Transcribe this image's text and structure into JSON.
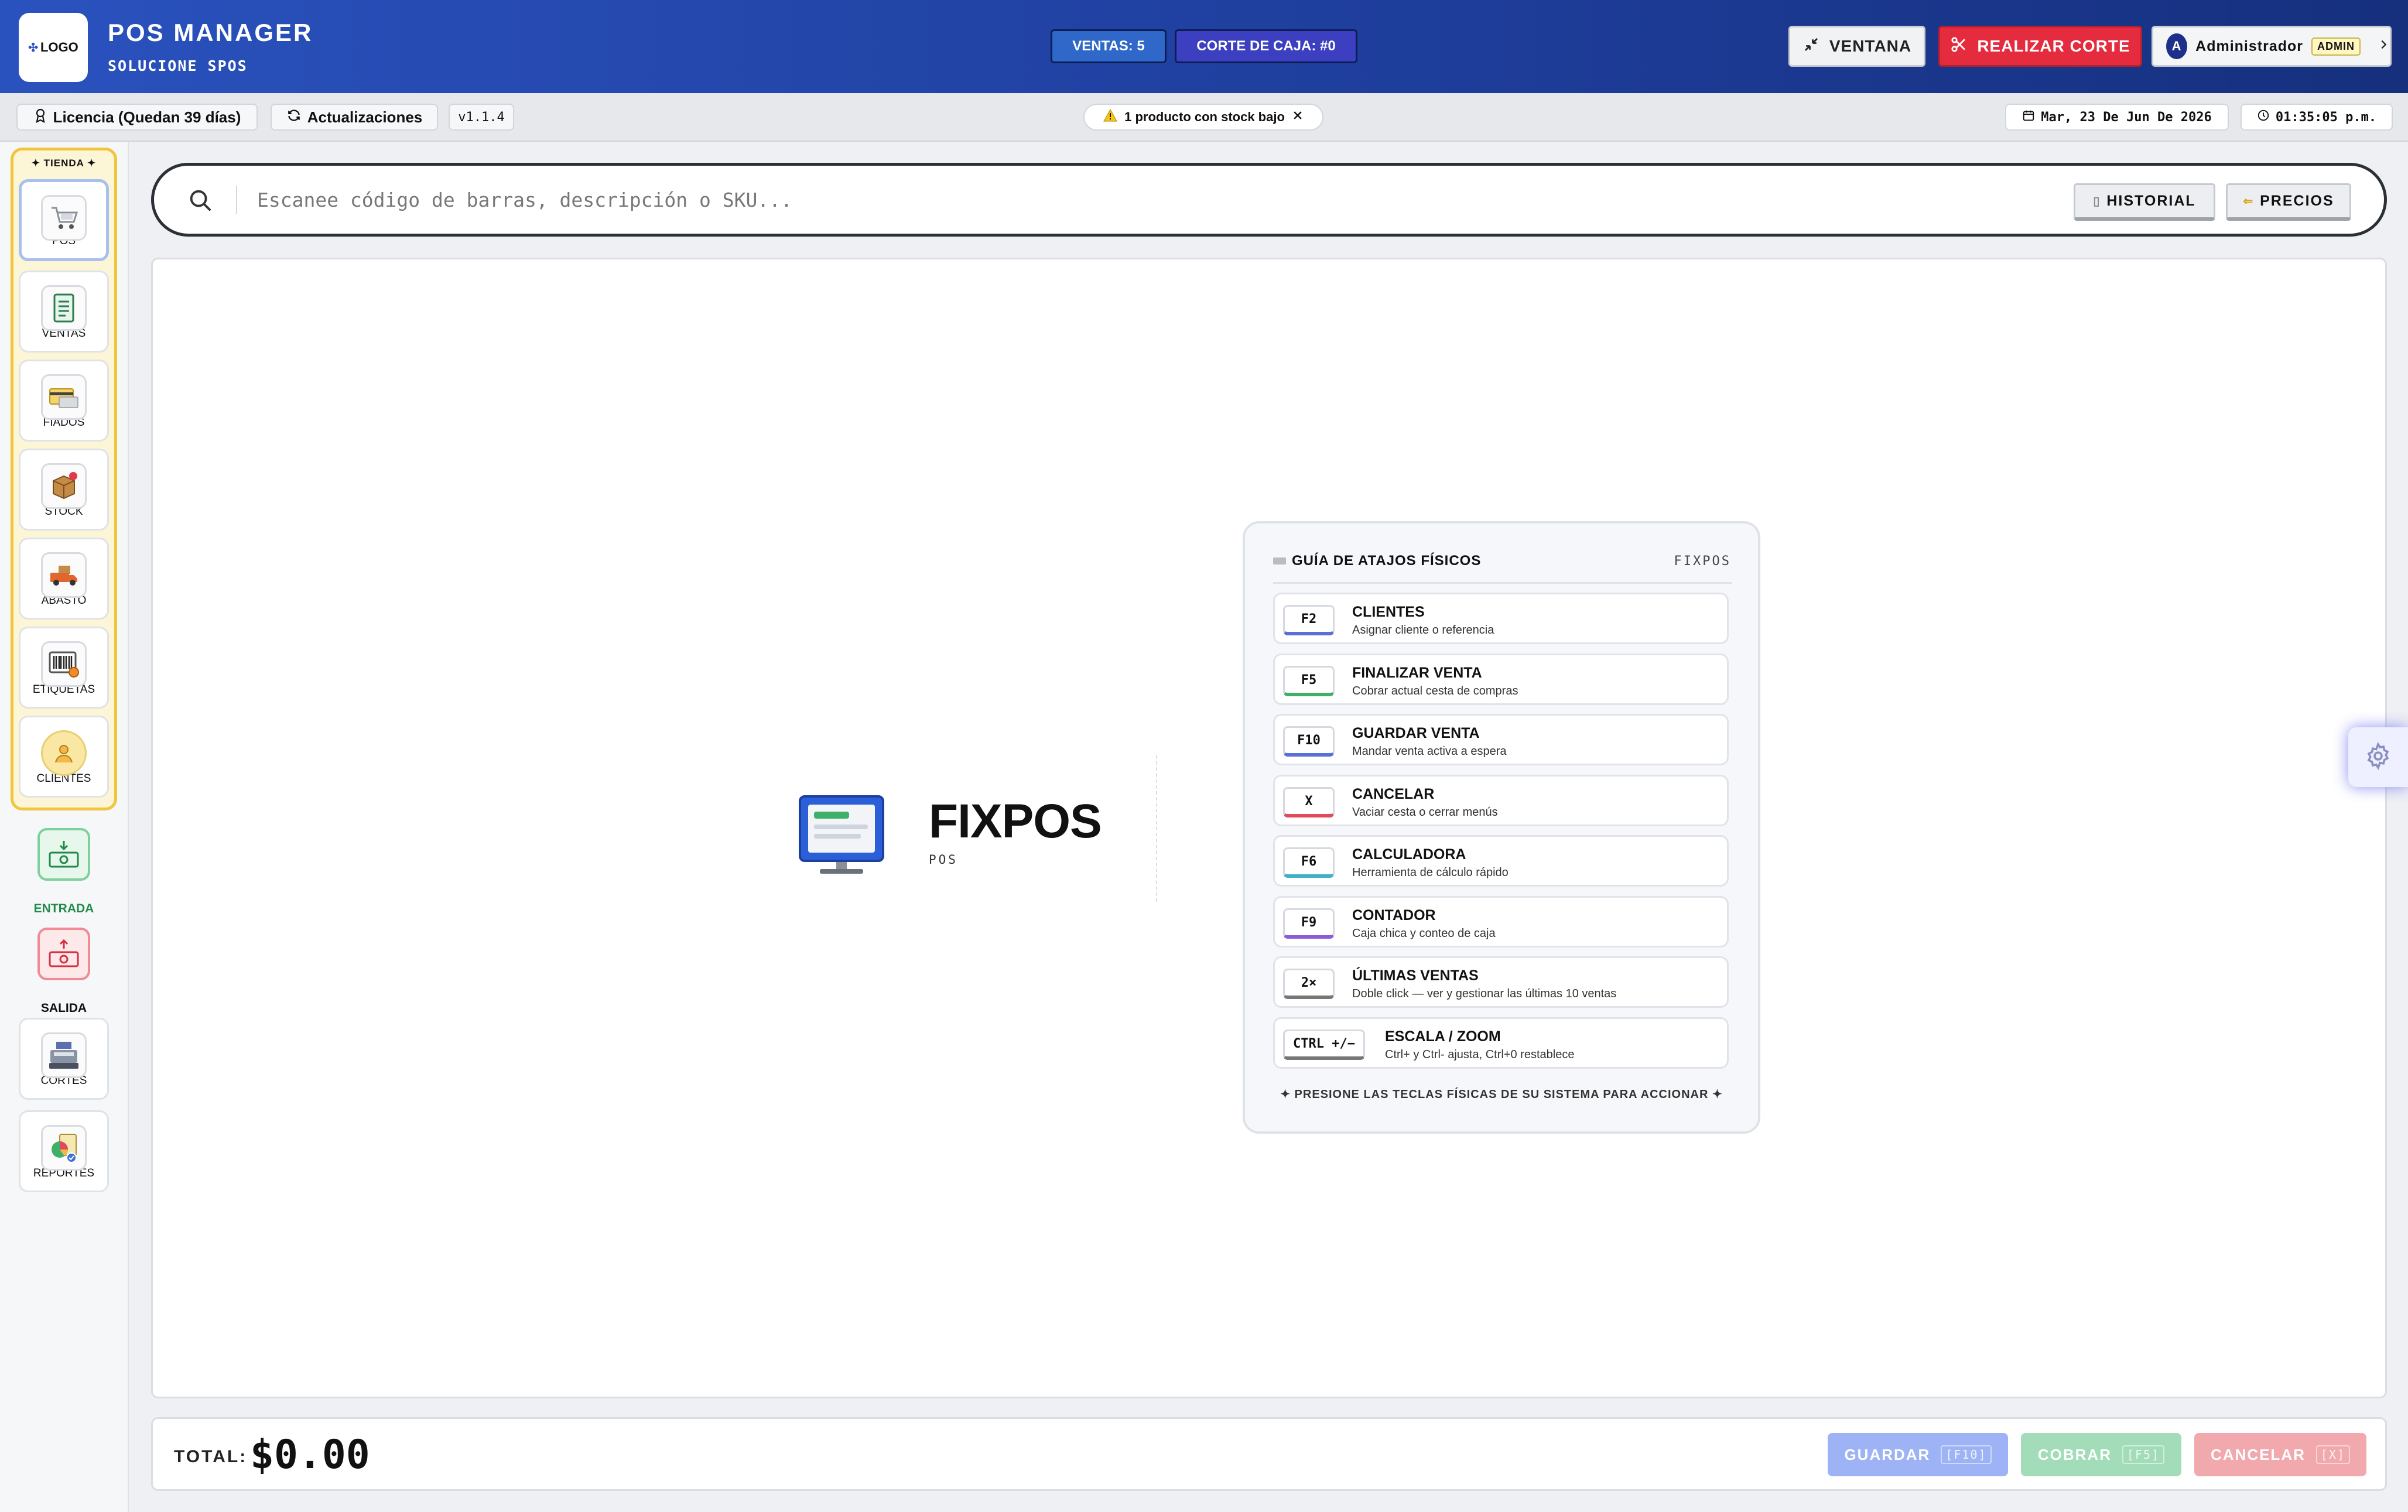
{
  "header": {
    "logo_text": "LOGO",
    "title": "POS MANAGER",
    "subtitle": "SOLUCIONE SPOS",
    "ventas_pill": "VENTAS: 5",
    "corte_pill": "CORTE DE CAJA: #0",
    "ventana_label": "VENTANA",
    "corte_label": "REALIZAR CORTE",
    "user_initial": "A",
    "user_name": "Administrador",
    "user_role": "ADMIN"
  },
  "subbar": {
    "license": "Licencia (Quedan 39 días)",
    "updates": "Actualizaciones",
    "version": "v1.1.4",
    "stock_alert": "1 producto con stock bajo",
    "date": "Mar, 23 De Jun De 2026",
    "time": "01:35:05 p.m."
  },
  "sidebar": {
    "group_label": "✦ TIENDA ✦",
    "items": [
      {
        "label": "POS"
      },
      {
        "label": "VENTAS"
      },
      {
        "label": "FIADOS"
      },
      {
        "label": "STOCK"
      },
      {
        "label": "ABASTO"
      },
      {
        "label": "ETIQUETAS"
      },
      {
        "label": "CLIENTES"
      }
    ],
    "entrada": "ENTRADA",
    "salida": "SALIDA",
    "cortes": "CORTES",
    "reportes": "REPORTES"
  },
  "search": {
    "placeholder": "Escanee código de barras, descripción o SKU...",
    "historial": "HISTORIAL",
    "precios": "PRECIOS"
  },
  "brand": {
    "name": "FIXPOS",
    "sub": "POS"
  },
  "guide": {
    "title": "GUÍA DE ATAJOS FÍSICOS",
    "brand": "FIXPOS",
    "rows": [
      {
        "key": "F2",
        "title": "CLIENTES",
        "desc": "Asignar cliente o referencia"
      },
      {
        "key": "F5",
        "title": "FINALIZAR VENTA",
        "desc": "Cobrar actual cesta de compras"
      },
      {
        "key": "F10",
        "title": "GUARDAR VENTA",
        "desc": "Mandar venta activa a espera"
      },
      {
        "key": "X",
        "title": "CANCELAR",
        "desc": "Vaciar cesta o cerrar menús"
      },
      {
        "key": "F6",
        "title": "CALCULADORA",
        "desc": "Herramienta de cálculo rápido"
      },
      {
        "key": "F9",
        "title": "CONTADOR",
        "desc": "Caja chica y conteo de caja"
      },
      {
        "key": "2×",
        "title": "ÚLTIMAS VENTAS",
        "desc": "Doble click — ver y gestionar las últimas 10 ventas"
      },
      {
        "key": "CTRL +/−",
        "title": "ESCALA / ZOOM",
        "desc": "Ctrl+ y Ctrl- ajusta, Ctrl+0 restablece"
      }
    ],
    "footer": "✦ PRESIONE LAS TECLAS FÍSICAS DE SU SISTEMA PARA ACCIONAR ✦",
    "key_colors": [
      "#5b6fd8",
      "#3fb06a",
      "#5b6fd8",
      "#e04b5a",
      "#3fb0c8",
      "#8b5cd8",
      "#777777",
      "#777777"
    ]
  },
  "footer": {
    "total_label": "TOTAL:",
    "total_value": "$0.00",
    "guardar": "GUARDAR",
    "guardar_key": "[F10]",
    "cobrar": "COBRAR",
    "cobrar_key": "[F5]",
    "cancelar": "CANCELAR",
    "cancelar_key": "[X]"
  },
  "colors": {
    "header_start": "#2a52be",
    "header_end": "#16307e",
    "accent_red": "#e52b3e",
    "tienda_border": "#f2c53d"
  }
}
